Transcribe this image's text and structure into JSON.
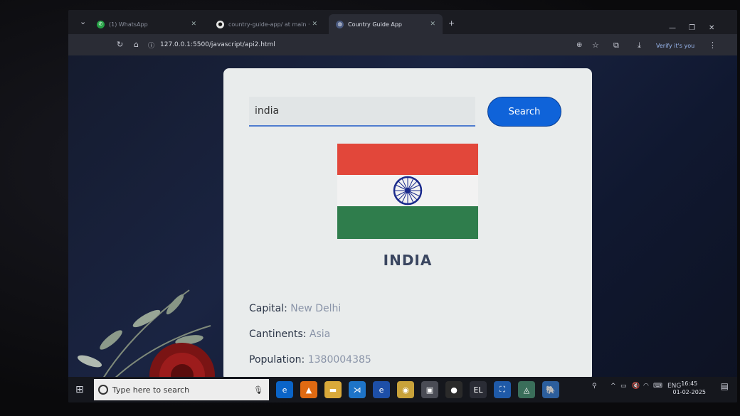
{
  "browser": {
    "tabs": [
      {
        "label": "(1) WhatsApp",
        "icon": "whatsapp-icon"
      },
      {
        "label": "country-guide-app/ at main ·",
        "icon": "github-icon"
      },
      {
        "label": "Country Guide App",
        "icon": "globe-icon",
        "active": true
      }
    ],
    "url": "127.0.0.1:5500/javascript/api2.html",
    "profile_label": "Verify it's you"
  },
  "search": {
    "value": "india",
    "button_label": "Search"
  },
  "country": {
    "name": "INDIA",
    "capital_label": "Capital:",
    "capital": "New Delhi",
    "continents_label": "Cantinents:",
    "continents": "Asia",
    "population_label": "Population:",
    "population": "1380004385"
  },
  "colors": {
    "flag_saffron": "#e2473a",
    "flag_white": "#f2f2f2",
    "flag_green": "#2f7d4c",
    "chakra": "#1a2a8c",
    "search_button": "#0f63d9"
  },
  "taskbar": {
    "search_placeholder": "Type here to search",
    "language": "ENG",
    "time": "16:45",
    "date": "01-02-2025"
  }
}
